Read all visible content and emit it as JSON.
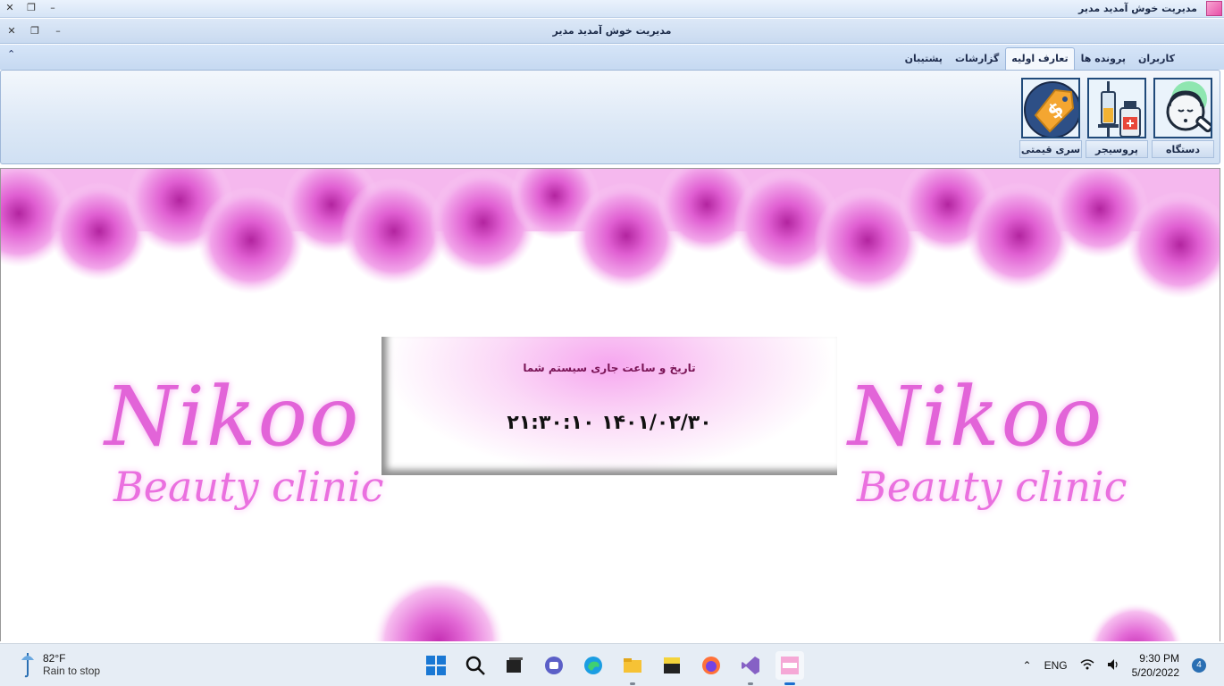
{
  "window": {
    "outer_title": "مدیریت خوش آمدید مدیر",
    "inner_title": "مدیریت خوش آمدید مدیر",
    "close_glyph": "✕",
    "restore_glyph": "❐",
    "minimize_glyph": "–"
  },
  "ribbon": {
    "collapse_glyph": "⌃",
    "tabs": [
      {
        "label": "کاربران"
      },
      {
        "label": "پرونده ها"
      },
      {
        "label": "تعارف اولیه"
      },
      {
        "label": "گزارشات"
      },
      {
        "label": "پشتیبان"
      }
    ],
    "active_tab": "تعارف اولیه",
    "buttons": [
      {
        "label": "دستگاه",
        "icon": "face-laser-device-icon"
      },
      {
        "label": "پروسیجر",
        "icon": "syringe-bottle-icon"
      },
      {
        "label": "سری قیمتی",
        "icon": "price-tag-icon"
      }
    ]
  },
  "main": {
    "brand_name": "Nikoo",
    "brand_sub": "Beauty clinic",
    "datetime_caption": "تاریخ و ساعت جاری سیستم شما",
    "datetime_value": "۱۴۰۱/۰۲/۳۰ ۲۱:۳۰:۱۰"
  },
  "taskbar": {
    "weather_temp": "82°F",
    "weather_condition": "Rain to stop",
    "apps": [
      "start-icon",
      "search-icon",
      "task-view-icon",
      "teams-chat-icon",
      "edge-icon",
      "file-explorer-icon",
      "sticky-notes-icon",
      "firefox-icon",
      "visual-studio-icon",
      "clinic-app-icon"
    ],
    "language": "ENG",
    "time": "9:30 PM",
    "date": "5/20/2022",
    "notification_count": "4"
  }
}
